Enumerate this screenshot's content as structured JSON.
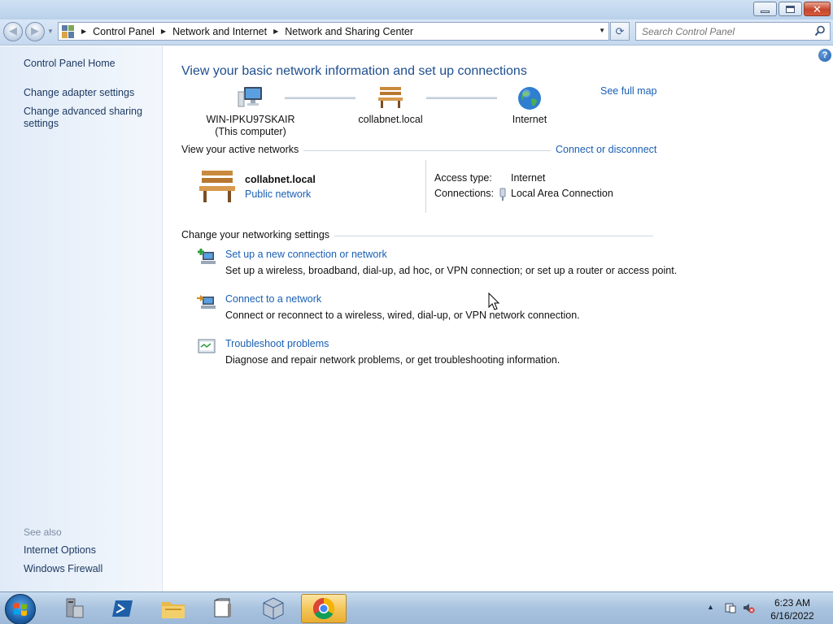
{
  "window": {
    "minimize_glyph": "",
    "close_glyph": "✕"
  },
  "navigation": {
    "back_glyph": "◀",
    "forward_glyph": "▶",
    "breadcrumbs": [
      "Control Panel",
      "Network and Internet",
      "Network and Sharing Center"
    ],
    "refresh_glyph": "⟳",
    "search_placeholder": "Search Control Panel"
  },
  "sidebar": {
    "home": "Control Panel Home",
    "tasks": [
      "Change adapter settings",
      "Change advanced sharing settings"
    ],
    "see_also_heading": "See also",
    "see_also": [
      "Internet Options",
      "Windows Firewall"
    ]
  },
  "main": {
    "help_glyph": "?",
    "title": "View your basic network information and set up connections",
    "see_full_map": "See full map",
    "map": {
      "computer_name": "WIN-IPKU97SKAIR",
      "computer_caption": "(This computer)",
      "network": "collabnet.local",
      "internet": "Internet"
    },
    "active_networks": {
      "heading": "View your active networks",
      "connect_link": "Connect or disconnect",
      "network_name": "collabnet.local",
      "network_type": "Public network",
      "access_type_label": "Access type:",
      "access_type_value": "Internet",
      "connections_label": "Connections:",
      "connections_value": "Local Area Connection"
    },
    "settings": {
      "heading": "Change your networking settings",
      "tasks": [
        {
          "icon": "new-connection-icon",
          "title": "Set up a new connection or network",
          "description": "Set up a wireless, broadband, dial-up, ad hoc, or VPN connection; or set up a router or access point."
        },
        {
          "icon": "connect-network-icon",
          "title": "Connect to a network",
          "description": "Connect or reconnect to a wireless, wired, dial-up, or VPN network connection."
        },
        {
          "icon": "troubleshoot-icon",
          "title": "Troubleshoot problems",
          "description": "Diagnose and repair network problems, or get troubleshooting information."
        }
      ]
    }
  },
  "taskbar": {
    "pinned": [
      "server-manager-icon",
      "powershell-icon",
      "file-explorer-icon",
      "file-manager-icon",
      "virtualbox-icon",
      "chrome-icon"
    ],
    "active_app": "chrome-icon",
    "tray_arrow": "▲",
    "time": "6:23 AM",
    "date": "6/16/2022"
  },
  "colors": {
    "link": "#1a5fb4",
    "title": "#1e4e8f",
    "sidebar_bg": "#e1ebf8"
  }
}
